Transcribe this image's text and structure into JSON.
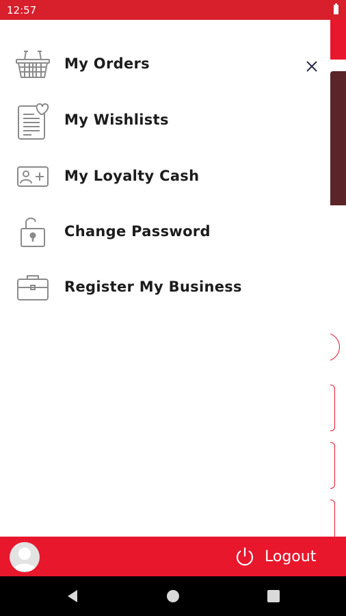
{
  "status_bar": {
    "time": "12:57"
  },
  "menu": {
    "items": [
      {
        "label": "My Orders",
        "icon": "basket-icon"
      },
      {
        "label": "My Wishlists",
        "icon": "wishlist-icon"
      },
      {
        "label": "My Loyalty Cash",
        "icon": "loyalty-card-icon"
      },
      {
        "label": "Change Password",
        "icon": "unlock-icon"
      },
      {
        "label": "Register My Business",
        "icon": "briefcase-icon"
      }
    ]
  },
  "footer": {
    "logout_label": "Logout"
  },
  "colors": {
    "brand_red": "#e8172c",
    "status_red": "#d81f2c",
    "icon_gray": "#8a8a8a"
  }
}
